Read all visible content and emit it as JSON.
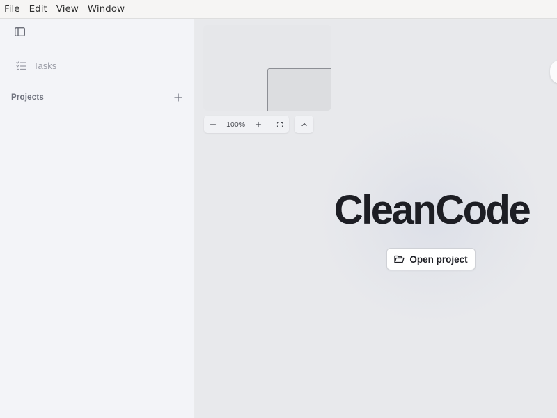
{
  "menubar": {
    "items": [
      "File",
      "Edit",
      "View",
      "Window"
    ]
  },
  "sidebar": {
    "toggle_icon": "sidebar-panel-icon",
    "nav": [
      {
        "label": "Tasks",
        "icon": "checklist-icon"
      }
    ],
    "projects": {
      "label": "Projects",
      "add_icon": "plus-icon"
    }
  },
  "canvas": {
    "zoom": {
      "value": "100%",
      "zoom_out_icon": "minus-icon",
      "zoom_in_icon": "plus-icon",
      "fit_icon": "fit-screen-icon"
    },
    "collapse_icon": "chevron-up-icon"
  },
  "welcome": {
    "brand": "CleanCode",
    "open_button_label": "Open project",
    "open_button_icon": "folder-open-icon"
  },
  "colors": {
    "sidebar_bg": "#f3f4f8",
    "canvas_bg": "#e8e9ec",
    "text_dark": "#1d1e24",
    "muted": "#9a9ca6"
  }
}
